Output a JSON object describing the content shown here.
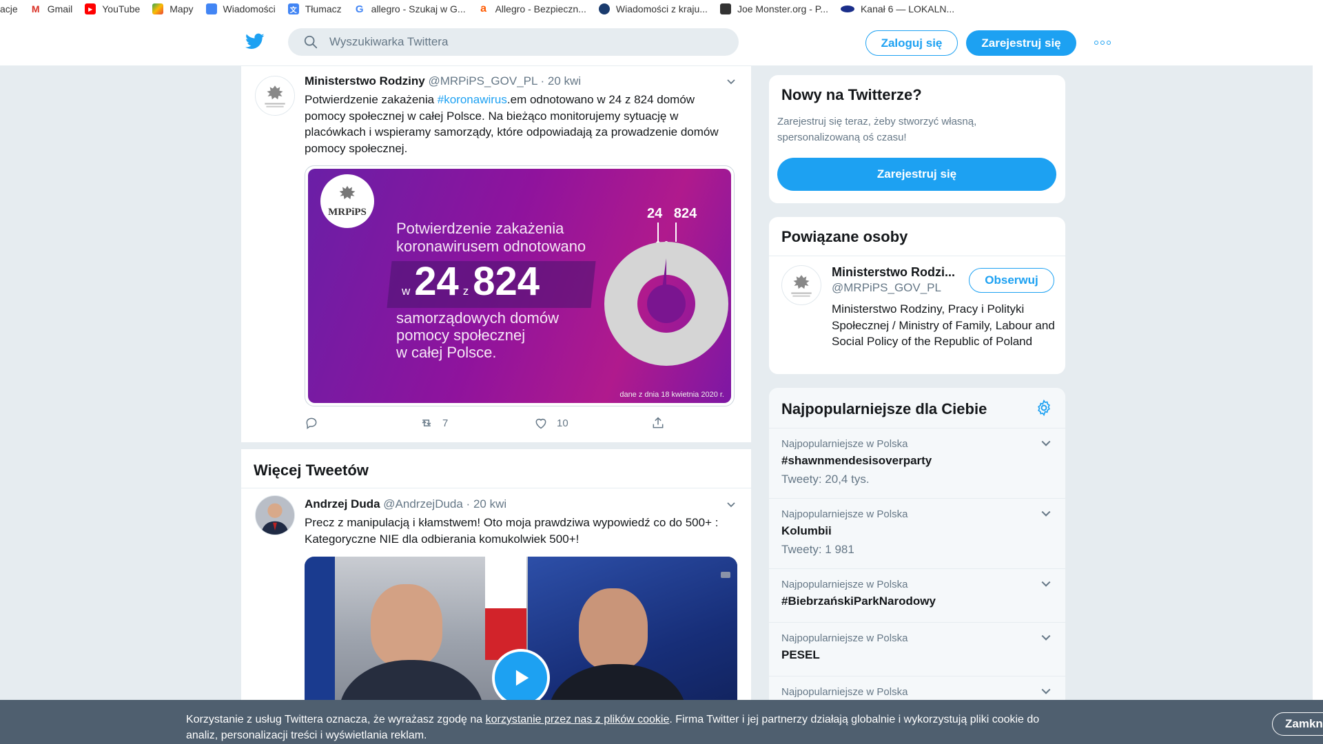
{
  "bookmarks": [
    {
      "label": "acje",
      "icon": "blank-icon"
    },
    {
      "label": "Gmail",
      "icon": "gmail-icon"
    },
    {
      "label": "YouTube",
      "icon": "youtube-icon"
    },
    {
      "label": "Mapy",
      "icon": "maps-icon"
    },
    {
      "label": "Wiadomości",
      "icon": "news-icon"
    },
    {
      "label": "Tłumacz",
      "icon": "translate-icon"
    },
    {
      "label": "allegro - Szukaj w G...",
      "icon": "google-icon"
    },
    {
      "label": "Allegro - Bezpieczn...",
      "icon": "allegro-icon"
    },
    {
      "label": "Wiadomości z kraju...",
      "icon": "globe-icon"
    },
    {
      "label": "Joe Monster.org - P...",
      "icon": "joemonster-icon"
    },
    {
      "label": "Kanał 6 — LOKALN...",
      "icon": "channel-icon"
    }
  ],
  "nav": {
    "search_placeholder": "Wyszukiwarka Twittera",
    "login_label": "Zaloguj się",
    "signup_label": "Zarejestruj się"
  },
  "tweet1": {
    "name": "Ministerstwo Rodziny",
    "meta": "@MRPiPS_GOV_PL · 20 kwi",
    "text_before": "Potwierdzenie zakażenia ",
    "hashtag": "#koronawirus",
    "text_after": ".em odnotowano w 24 z 824 domów pomocy społecznej w całej Polsce. Na bieżąco monitorujemy sytuację w placówkach i wspieramy samorządy, które odpowiadają za prowadzenie domów pomocy społecznej.",
    "retweets": "7",
    "likes": "10",
    "graphic": {
      "logo_text": "MRPiPS",
      "line1a": "Potwierdzenie zakażenia",
      "line1b": "koronawirusem odnotowano",
      "w": "w",
      "num1": "24",
      "z": "z",
      "num2": "824",
      "line2a": "samorządowych domów",
      "line2b": "pomocy społecznej",
      "line2c": "w całej Polsce.",
      "label_a": "24",
      "label_b": "824",
      "footer": "dane z dnia 18 kwietnia 2020 r."
    }
  },
  "more_tweets_title": "Więcej Tweetów",
  "tweet2": {
    "name": "Andrzej Duda",
    "meta": "@AndrzejDuda · 20 kwi",
    "text": "Precz z manipulacją i kłamstwem! Oto moja prawdziwa wypowiedź co do 500+ : Kategoryczne NIE dla odbierania komukolwiek 500+!"
  },
  "sidebar": {
    "new": {
      "title": "Nowy na Twitterze?",
      "desc": "Zarejestruj się teraz, żeby stworzyć własną, spersonalizowaną oś czasu!",
      "button": "Zarejestruj się"
    },
    "related": {
      "title": "Powiązane osoby",
      "name": "Ministerstwo Rodzi...",
      "handle": "@MRPiPS_GOV_PL",
      "follow": "Obserwuj",
      "bio": "Ministerstwo Rodziny, Pracy i Polityki Społecznej / Ministry of Family, Labour and Social Policy of the Republic of Poland"
    },
    "trends": {
      "title": "Najpopularniejsze dla Ciebie",
      "items": [
        {
          "context": "Najpopularniejsze w Polska",
          "name": "#shawnmendesisoverparty",
          "count": "Tweety: 20,4 tys."
        },
        {
          "context": "Najpopularniejsze w Polska",
          "name": "Kolumbii",
          "count": "Tweety: 1 981"
        },
        {
          "context": "Najpopularniejsze w Polska",
          "name": "#BiebrzańskiParkNarodowy",
          "count": ""
        },
        {
          "context": "Najpopularniejsze w Polska",
          "name": "PESEL",
          "count": ""
        },
        {
          "context": "Najpopularniejsze w Polska",
          "name": "",
          "count": ""
        }
      ]
    }
  },
  "cookie": {
    "text_before": "Korzystanie z usług Twittera oznacza, że wyrażasz zgodę na ",
    "link": "korzystanie przez nas z plików cookie",
    "text_after": ". Firma Twitter i jej partnerzy działają globalnie i wykorzystują pliki cookie do analiz, personalizacji treści i wyświetlania reklam.",
    "close": "Zamknij"
  },
  "colors": {
    "accent": "#1da1f2",
    "graphic_bg": "#8f139d"
  }
}
